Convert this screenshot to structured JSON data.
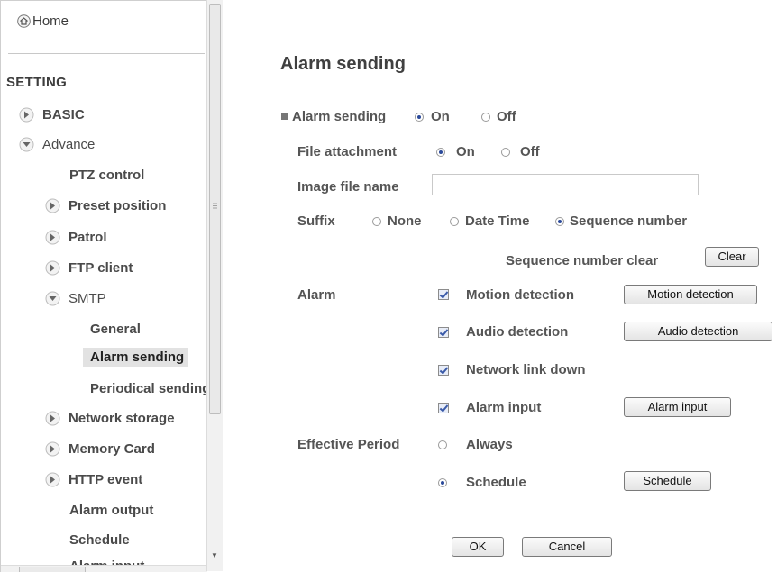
{
  "sidebar": {
    "home": "Home",
    "setting": "SETTING",
    "items": [
      {
        "label": "BASIC"
      },
      {
        "label": "Advance"
      },
      {
        "label": "PTZ control"
      },
      {
        "label": "Preset position"
      },
      {
        "label": "Patrol"
      },
      {
        "label": "FTP client"
      },
      {
        "label": "SMTP"
      },
      {
        "label": "General"
      },
      {
        "label": "Alarm sending"
      },
      {
        "label": "Periodical sending"
      },
      {
        "label": "Network storage"
      },
      {
        "label": "Memory Card"
      },
      {
        "label": "HTTP event"
      },
      {
        "label": "Alarm output"
      },
      {
        "label": "Schedule"
      },
      {
        "label": "Alarm input"
      }
    ]
  },
  "main": {
    "title": "Alarm sending",
    "alarm_sending": {
      "label": "Alarm sending",
      "on": "On",
      "off": "Off",
      "selected": "On"
    },
    "file_attachment": {
      "label": "File attachment",
      "on": "On",
      "off": "Off",
      "selected": "On"
    },
    "image_file_name": {
      "label": "Image file name",
      "value": ""
    },
    "suffix": {
      "label": "Suffix",
      "options": [
        "None",
        "Date Time",
        "Sequence number"
      ],
      "selected": "Sequence number"
    },
    "sequence_clear": {
      "label": "Sequence number clear",
      "button": "Clear"
    },
    "alarm": {
      "label": "Alarm",
      "items": [
        {
          "label": "Motion detection",
          "checked": true,
          "button": "Motion detection"
        },
        {
          "label": "Audio detection",
          "checked": true,
          "button": "Audio detection"
        },
        {
          "label": "Network link down",
          "checked": true
        },
        {
          "label": "Alarm input",
          "checked": true,
          "button": "Alarm input"
        }
      ]
    },
    "effective_period": {
      "label": "Effective Period",
      "always": "Always",
      "schedule": "Schedule",
      "selected": "Schedule",
      "schedule_button": "Schedule"
    },
    "ok": "OK",
    "cancel": "Cancel"
  },
  "colors": {
    "accent": "#2b4a9a",
    "text": "#555555",
    "active_bg": "#e2e2e2"
  }
}
